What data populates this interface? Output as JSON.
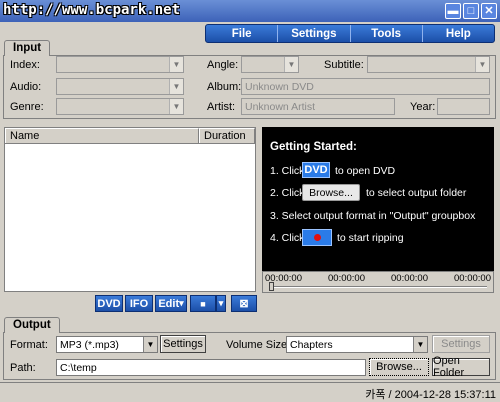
{
  "titlebar": {
    "watermark": "http://www.bcpark.net",
    "buttons": {
      "minimize": "▬",
      "maximize": "□",
      "close": "✕"
    }
  },
  "menu": [
    "File",
    "Settings",
    "Tools",
    "Help"
  ],
  "input": {
    "tab": "Input",
    "labels": {
      "index": "Index:",
      "audio": "Audio:",
      "genre": "Genre:",
      "angle": "Angle:",
      "album": "Album:",
      "artist": "Artist:",
      "subtitle": "Subtitle:",
      "year": "Year:"
    },
    "album_placeholder": "Unknown DVD",
    "artist_placeholder": "Unknown Artist",
    "list_columns": [
      "Name",
      "Duration"
    ]
  },
  "guide": {
    "title": "Getting Started:",
    "step1_pre": "1. Click",
    "step1_btn": "DVD",
    "step1_post": "to open DVD",
    "step2_pre": "2. Click",
    "step2_btn": "Browse...",
    "step2_post": "to select output folder",
    "step3": "3. Select output format in \"Output\" groupbox",
    "step4_pre": "4. Click",
    "step4_post": "to start ripping"
  },
  "timeline": {
    "times": [
      "00:00:00",
      "00:00:00",
      "00:00:00",
      "00:00:00"
    ]
  },
  "toolbar": {
    "dvd": "DVD",
    "ifo": "IFO",
    "edit": "Edit",
    "stop_glyph": "■",
    "dropdown_glyph": "▾",
    "img_glyph": "⊠"
  },
  "output": {
    "tab": "Output",
    "format_label": "Format:",
    "format_value": "MP3 (*.mp3)",
    "settings_label": "Settings",
    "volume_label": "Volume Size:",
    "volume_value": "Chapters",
    "settings2_label": "Settings",
    "path_label": "Path:",
    "path_value": "C:\\temp",
    "browse_label": "Browse...",
    "open_label": "Open Folder"
  },
  "status": "카폭 / 2004-12-28 15:37:11"
}
